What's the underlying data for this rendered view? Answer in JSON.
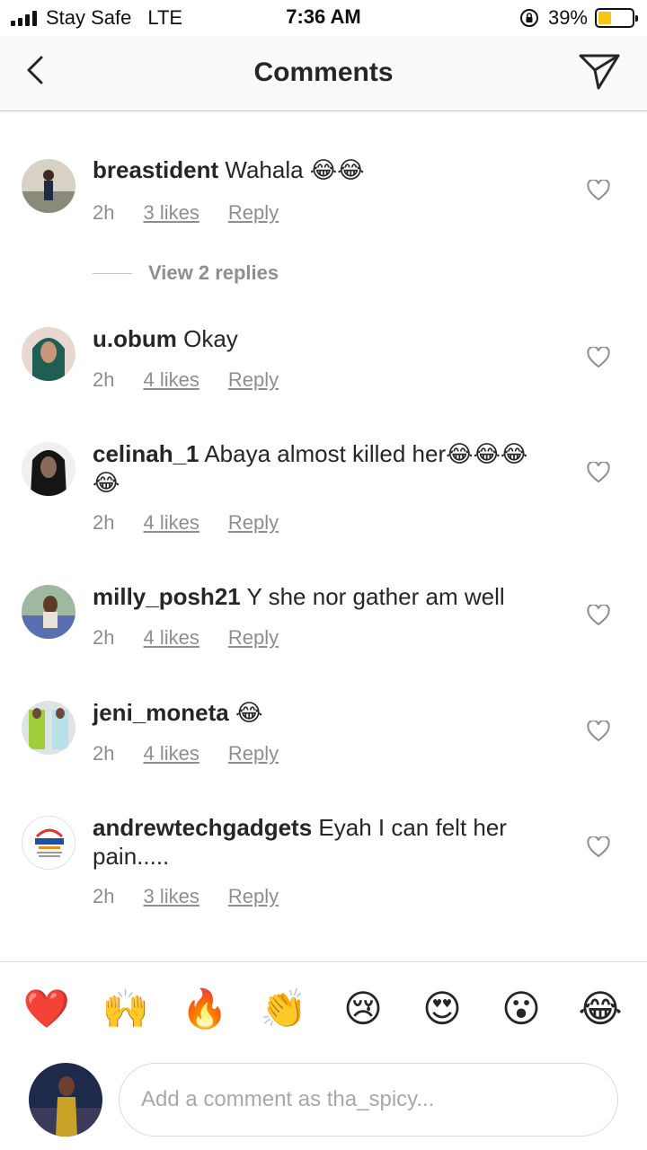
{
  "status_bar": {
    "carrier": "Stay Safe",
    "network": "LTE",
    "time": "7:36 AM",
    "battery_percent": "39%",
    "battery_level": 0.39,
    "battery_color": "#f5c518",
    "signal_icon": "signal-bars-icon",
    "lock_icon": "rotation-lock-icon"
  },
  "header": {
    "title": "Comments",
    "back_icon": "chevron-left-icon",
    "share_icon": "paper-plane-icon"
  },
  "comments": [
    {
      "username": "breastident",
      "text": "Wahala 😂😂",
      "time": "2h",
      "likes": "3 likes",
      "reply": "Reply"
    },
    {
      "username": "u.obum",
      "text": "Okay",
      "time": "2h",
      "likes": "4 likes",
      "reply": "Reply"
    },
    {
      "username": "celinah_1",
      "text": "Abaya almost killed her😂😂😂😂",
      "time": "2h",
      "likes": "4 likes",
      "reply": "Reply"
    },
    {
      "username": "milly_posh21",
      "text": "Y she nor gather am well",
      "time": "2h",
      "likes": "4 likes",
      "reply": "Reply"
    },
    {
      "username": "jeni_moneta",
      "text": "😂",
      "time": "2h",
      "likes": "4 likes",
      "reply": "Reply"
    },
    {
      "username": "andrewtechgadgets",
      "text": "Eyah I can felt her pain.....",
      "time": "2h",
      "likes": "3 likes",
      "reply": "Reply"
    }
  ],
  "view_replies": "View 2 replies",
  "emoji_bar": [
    "❤️",
    "🙌",
    "🔥",
    "👏",
    "😢",
    "😍",
    "😮",
    "😂"
  ],
  "composer": {
    "placeholder": "Add a comment as tha_spicy..."
  }
}
